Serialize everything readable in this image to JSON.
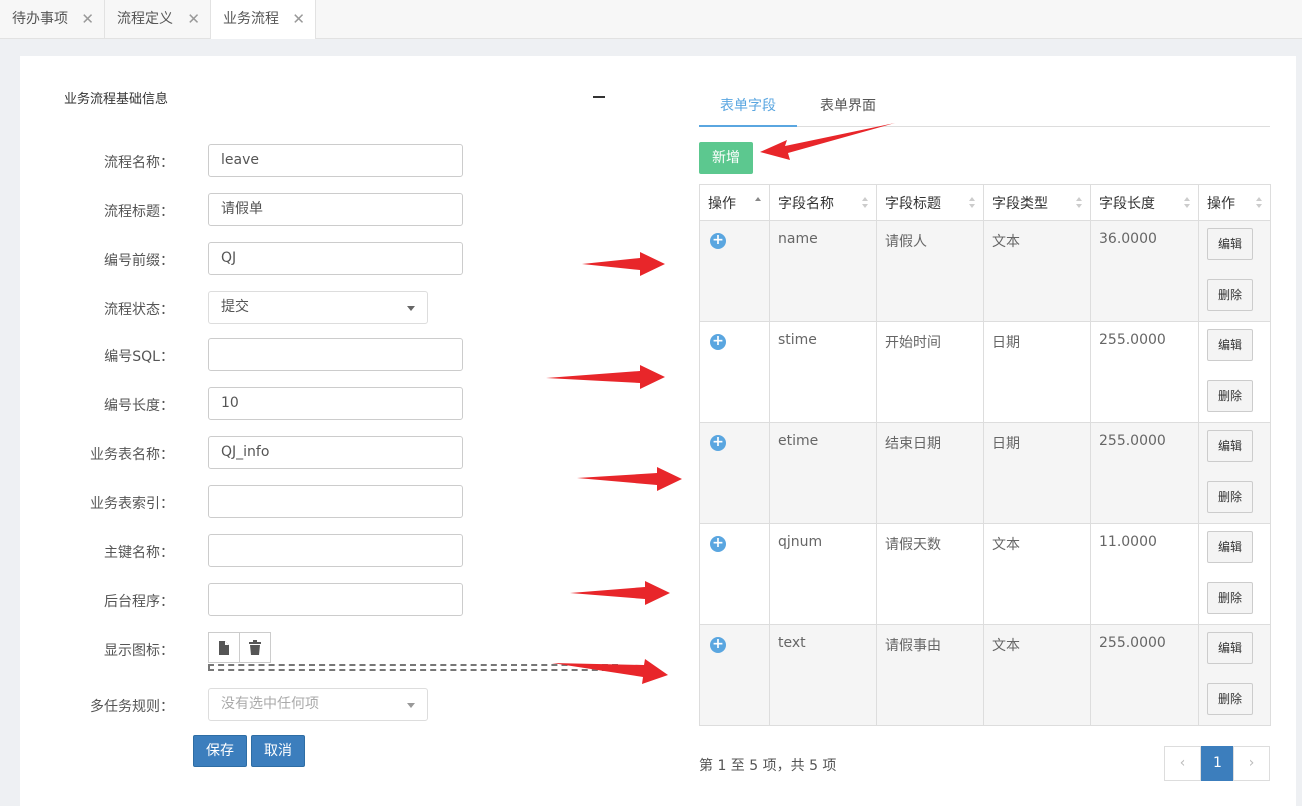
{
  "tabs": [
    {
      "label": "待办事项",
      "close": "✕"
    },
    {
      "label": "流程定义",
      "close": "✕"
    },
    {
      "label": "业务流程",
      "close": "✕"
    }
  ],
  "section": {
    "title": "业务流程基础信息"
  },
  "form": {
    "name_label": "流程名称：",
    "name_value": "leave",
    "title_label": "流程标题：",
    "title_value": "请假单",
    "prefix_label": "编号前缀：",
    "prefix_value": "QJ",
    "status_label": "流程状态：",
    "status_value": "提交",
    "sql_label": "编号SQL：",
    "sql_value": "",
    "length_label": "编号长度：",
    "length_value": "10",
    "table_label": "业务表名称：",
    "table_value": "QJ_info",
    "index_label": "业务表索引：",
    "index_value": "",
    "key_label": "主键名称：",
    "key_value": "",
    "backend_label": "后台程序：",
    "backend_value": "",
    "icon_label": "显示图标：",
    "multi_label": "多任务规则：",
    "multi_placeholder": "没有选中任何项",
    "save": "保存",
    "cancel": "取消"
  },
  "right_tabs": [
    "表单字段",
    "表单界面"
  ],
  "add_button": "新增",
  "grid": {
    "headers": [
      "操作",
      "字段名称",
      "字段标题",
      "字段类型",
      "字段长度",
      "操作"
    ],
    "rows": [
      {
        "name": "name",
        "title": "请假人",
        "type": "文本",
        "length": "36.0000"
      },
      {
        "name": "stime",
        "title": "开始时间",
        "type": "日期",
        "length": "255.0000"
      },
      {
        "name": "etime",
        "title": "结束日期",
        "type": "日期",
        "length": "255.0000"
      },
      {
        "name": "qjnum",
        "title": "请假天数",
        "type": "文本",
        "length": "11.0000"
      },
      {
        "name": "text",
        "title": "请假事由",
        "type": "文本",
        "length": "255.0000"
      }
    ],
    "edit": "编辑",
    "delete": "删除"
  },
  "pager": {
    "info": "第 1 至 5 项，共 5 项",
    "prev": "‹",
    "page": "1",
    "next": "›"
  },
  "colors": {
    "primary": "#3c7ebd",
    "success": "#5cc88f",
    "accent": "#5aa6e0",
    "annotation": "#e8262a"
  }
}
